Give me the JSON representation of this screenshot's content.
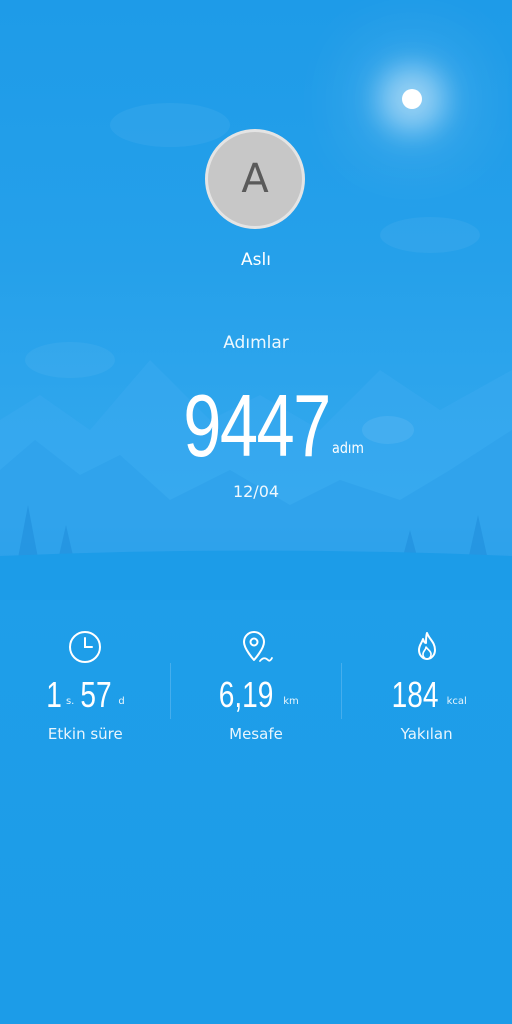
{
  "profile": {
    "avatar_initial": "A",
    "name": "Aslı"
  },
  "steps": {
    "label": "Adımlar",
    "value": "9447",
    "unit": "adım",
    "date": "12/04"
  },
  "stats": {
    "active_time": {
      "icon": "clock-icon",
      "hours": "1",
      "hours_unit": "s.",
      "minutes": "57",
      "minutes_unit": "d",
      "label": "Etkin süre"
    },
    "distance": {
      "icon": "location-pin-icon",
      "value": "6,19",
      "unit": "km",
      "label": "Mesafe"
    },
    "calories": {
      "icon": "flame-icon",
      "value": "184",
      "unit": "kcal",
      "label": "Yakılan"
    }
  },
  "colors": {
    "background": "#1e9be8",
    "avatar_bg": "#c7c7c7",
    "text": "#ffffff"
  }
}
